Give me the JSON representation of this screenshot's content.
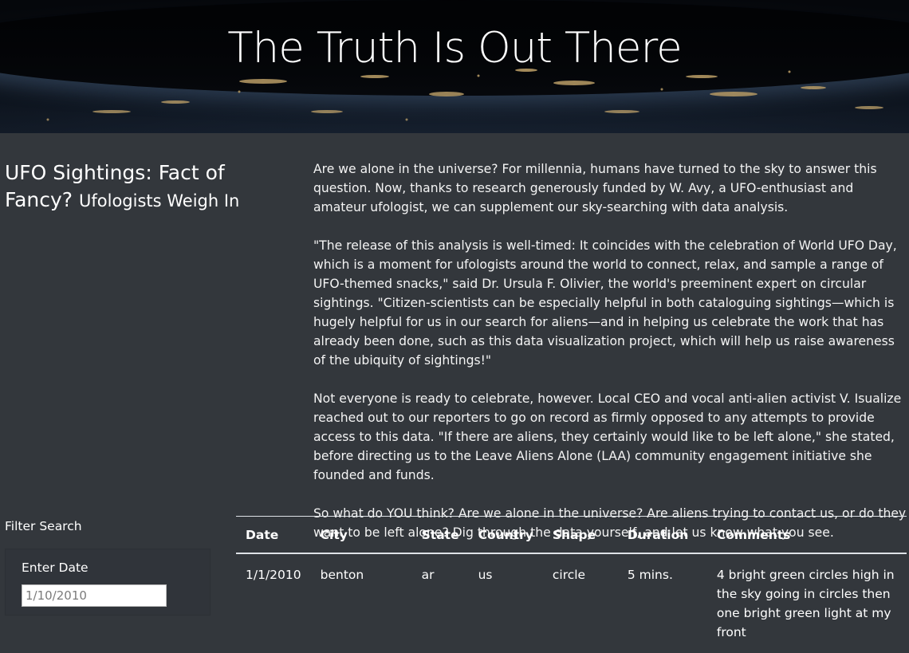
{
  "hero": {
    "title": "The Truth Is Out There"
  },
  "headline": {
    "main": "UFO Sightings: Fact of Fancy?",
    "sub": "Ufologists Weigh In"
  },
  "article": {
    "paragraphs": [
      "Are we alone in the universe? For millennia, humans have turned to the sky to answer this question. Now, thanks to research generously funded by W. Avy, a UFO-enthusiast and amateur ufologist, we can supplement our sky-searching with data analysis.",
      "\"The release of this analysis is well-timed: It coincides with the celebration of World UFO Day, which is a moment for ufologists around the world to connect, relax, and sample a range of UFO-themed snacks,\" said Dr. Ursula F. Olivier, the world's preeminent expert on circular sightings. \"Citizen-scientists can be especially helpful in both cataloguing sightings—which is hugely helpful for us in our search for aliens—and in helping us celebrate the work that has already been done, such as this data visualization project, which will help us raise awareness of the ubiquity of sightings!\"",
      "Not everyone is ready to celebrate, however. Local CEO and vocal anti-alien activist V. Isualize reached out to our reporters to go on record as firmly opposed to any attempts to provide access to this data. \"If there are aliens, they certainly would like to be left alone,\" she stated, before directing us to the Leave Aliens Alone (LAA) community engagement initiative she founded and funds.",
      "So what do YOU think? Are we alone in the universe? Are aliens trying to contact us, or do they want to be left alone? Dig through the data yourself, and let us know what you see."
    ]
  },
  "filter": {
    "title": "Filter Search",
    "date_label": "Enter Date",
    "date_placeholder": "1/10/2010"
  },
  "table": {
    "headers": [
      "Date",
      "City",
      "State",
      "Country",
      "Shape",
      "Duration",
      "Comments"
    ],
    "rows": [
      [
        "1/1/2010",
        "benton",
        "ar",
        "us",
        "circle",
        "5 mins.",
        "4 bright green circles high in the sky going in circles then one bright green light at my front"
      ]
    ]
  }
}
